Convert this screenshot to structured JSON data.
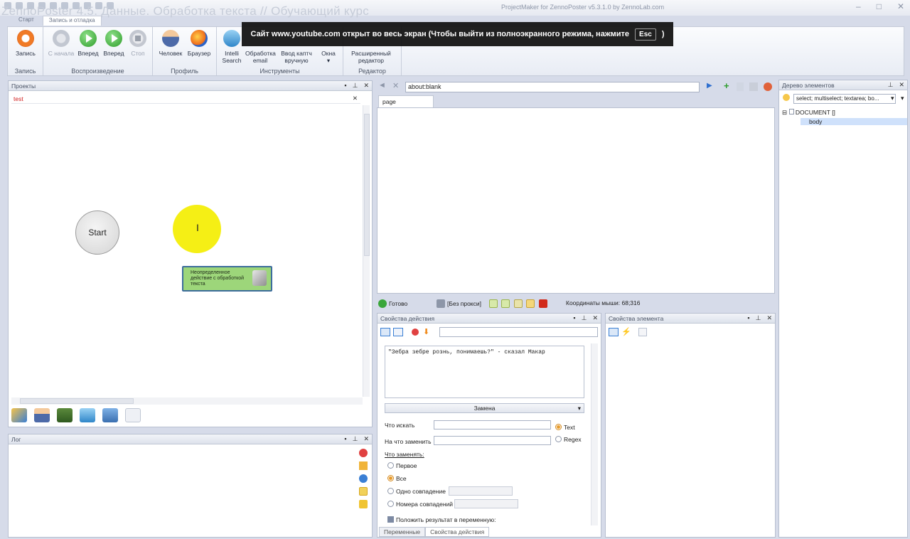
{
  "overlay_title": "ZennoPoster 4.5. Данные. Обработка текста // Обучающий курс",
  "app_title": "ProjectMaker for ZennoPoster v5.3.1.0 by ZennoLab.com",
  "ribbon": {
    "tabs": [
      "Старт",
      "Запись и отладка"
    ],
    "groups": [
      {
        "label": "Запись",
        "buttons": [
          "Запись"
        ]
      },
      {
        "label": "Воспроизведение",
        "buttons": [
          "С начала",
          "Вперед",
          "Вперед",
          "Стоп"
        ]
      },
      {
        "label": "Профиль",
        "buttons": [
          "Человек",
          "Браузер"
        ]
      },
      {
        "label": "Инструменты",
        "buttons": [
          "Intelli Search",
          "Обработка email",
          "Ввод каптч вручную",
          "Окна"
        ]
      },
      {
        "label": "Редактор",
        "buttons": [
          "Расширенный редактор"
        ]
      }
    ]
  },
  "youtube_notice": {
    "text": "Сайт www.youtube.com открыт во весь экран (Чтобы выйти из полноэкранного режима, нажмите",
    "key": "Esc",
    "end": ")"
  },
  "projects": {
    "title": "Проекты",
    "tab": "test",
    "start_node": "Start",
    "action_node": "Неопределенное действие с обработкой текста"
  },
  "log": {
    "title": "Лог"
  },
  "browser": {
    "url": "about:blank",
    "page_tab": "page"
  },
  "status": {
    "ready": "Готово",
    "proxy": "[Без прокси]",
    "coords": "Координаты мыши: 68;316"
  },
  "action_props": {
    "title": "Свойства действия",
    "text_value": "\"Зебра зебре рознь, понимаешь?\" - сказал Макар",
    "operation": "Замена",
    "find_label": "Что искать",
    "replace_label": "На что заменить",
    "mode_text": "Text",
    "mode_regex": "Regex",
    "what_replace_label": "Что заменять:",
    "opt_first": "Первое",
    "opt_all": "Все",
    "opt_one": "Одно совпадение",
    "opt_numbers": "Номера совпадений",
    "put_result": "Положить результат в переменную:",
    "tabs": [
      "Переменные",
      "Свойства действия"
    ]
  },
  "element_props": {
    "title": "Свойства элемента"
  },
  "tree": {
    "title": "Дерево элементов",
    "filter": "select; multiselect; textarea; bo...",
    "nodes": [
      "DOCUMENT []",
      "body"
    ]
  },
  "colors": {
    "accent": "#3c6c9c",
    "action_node_fill": "#9dd67a",
    "cursor_highlight": "#f5ef15"
  }
}
